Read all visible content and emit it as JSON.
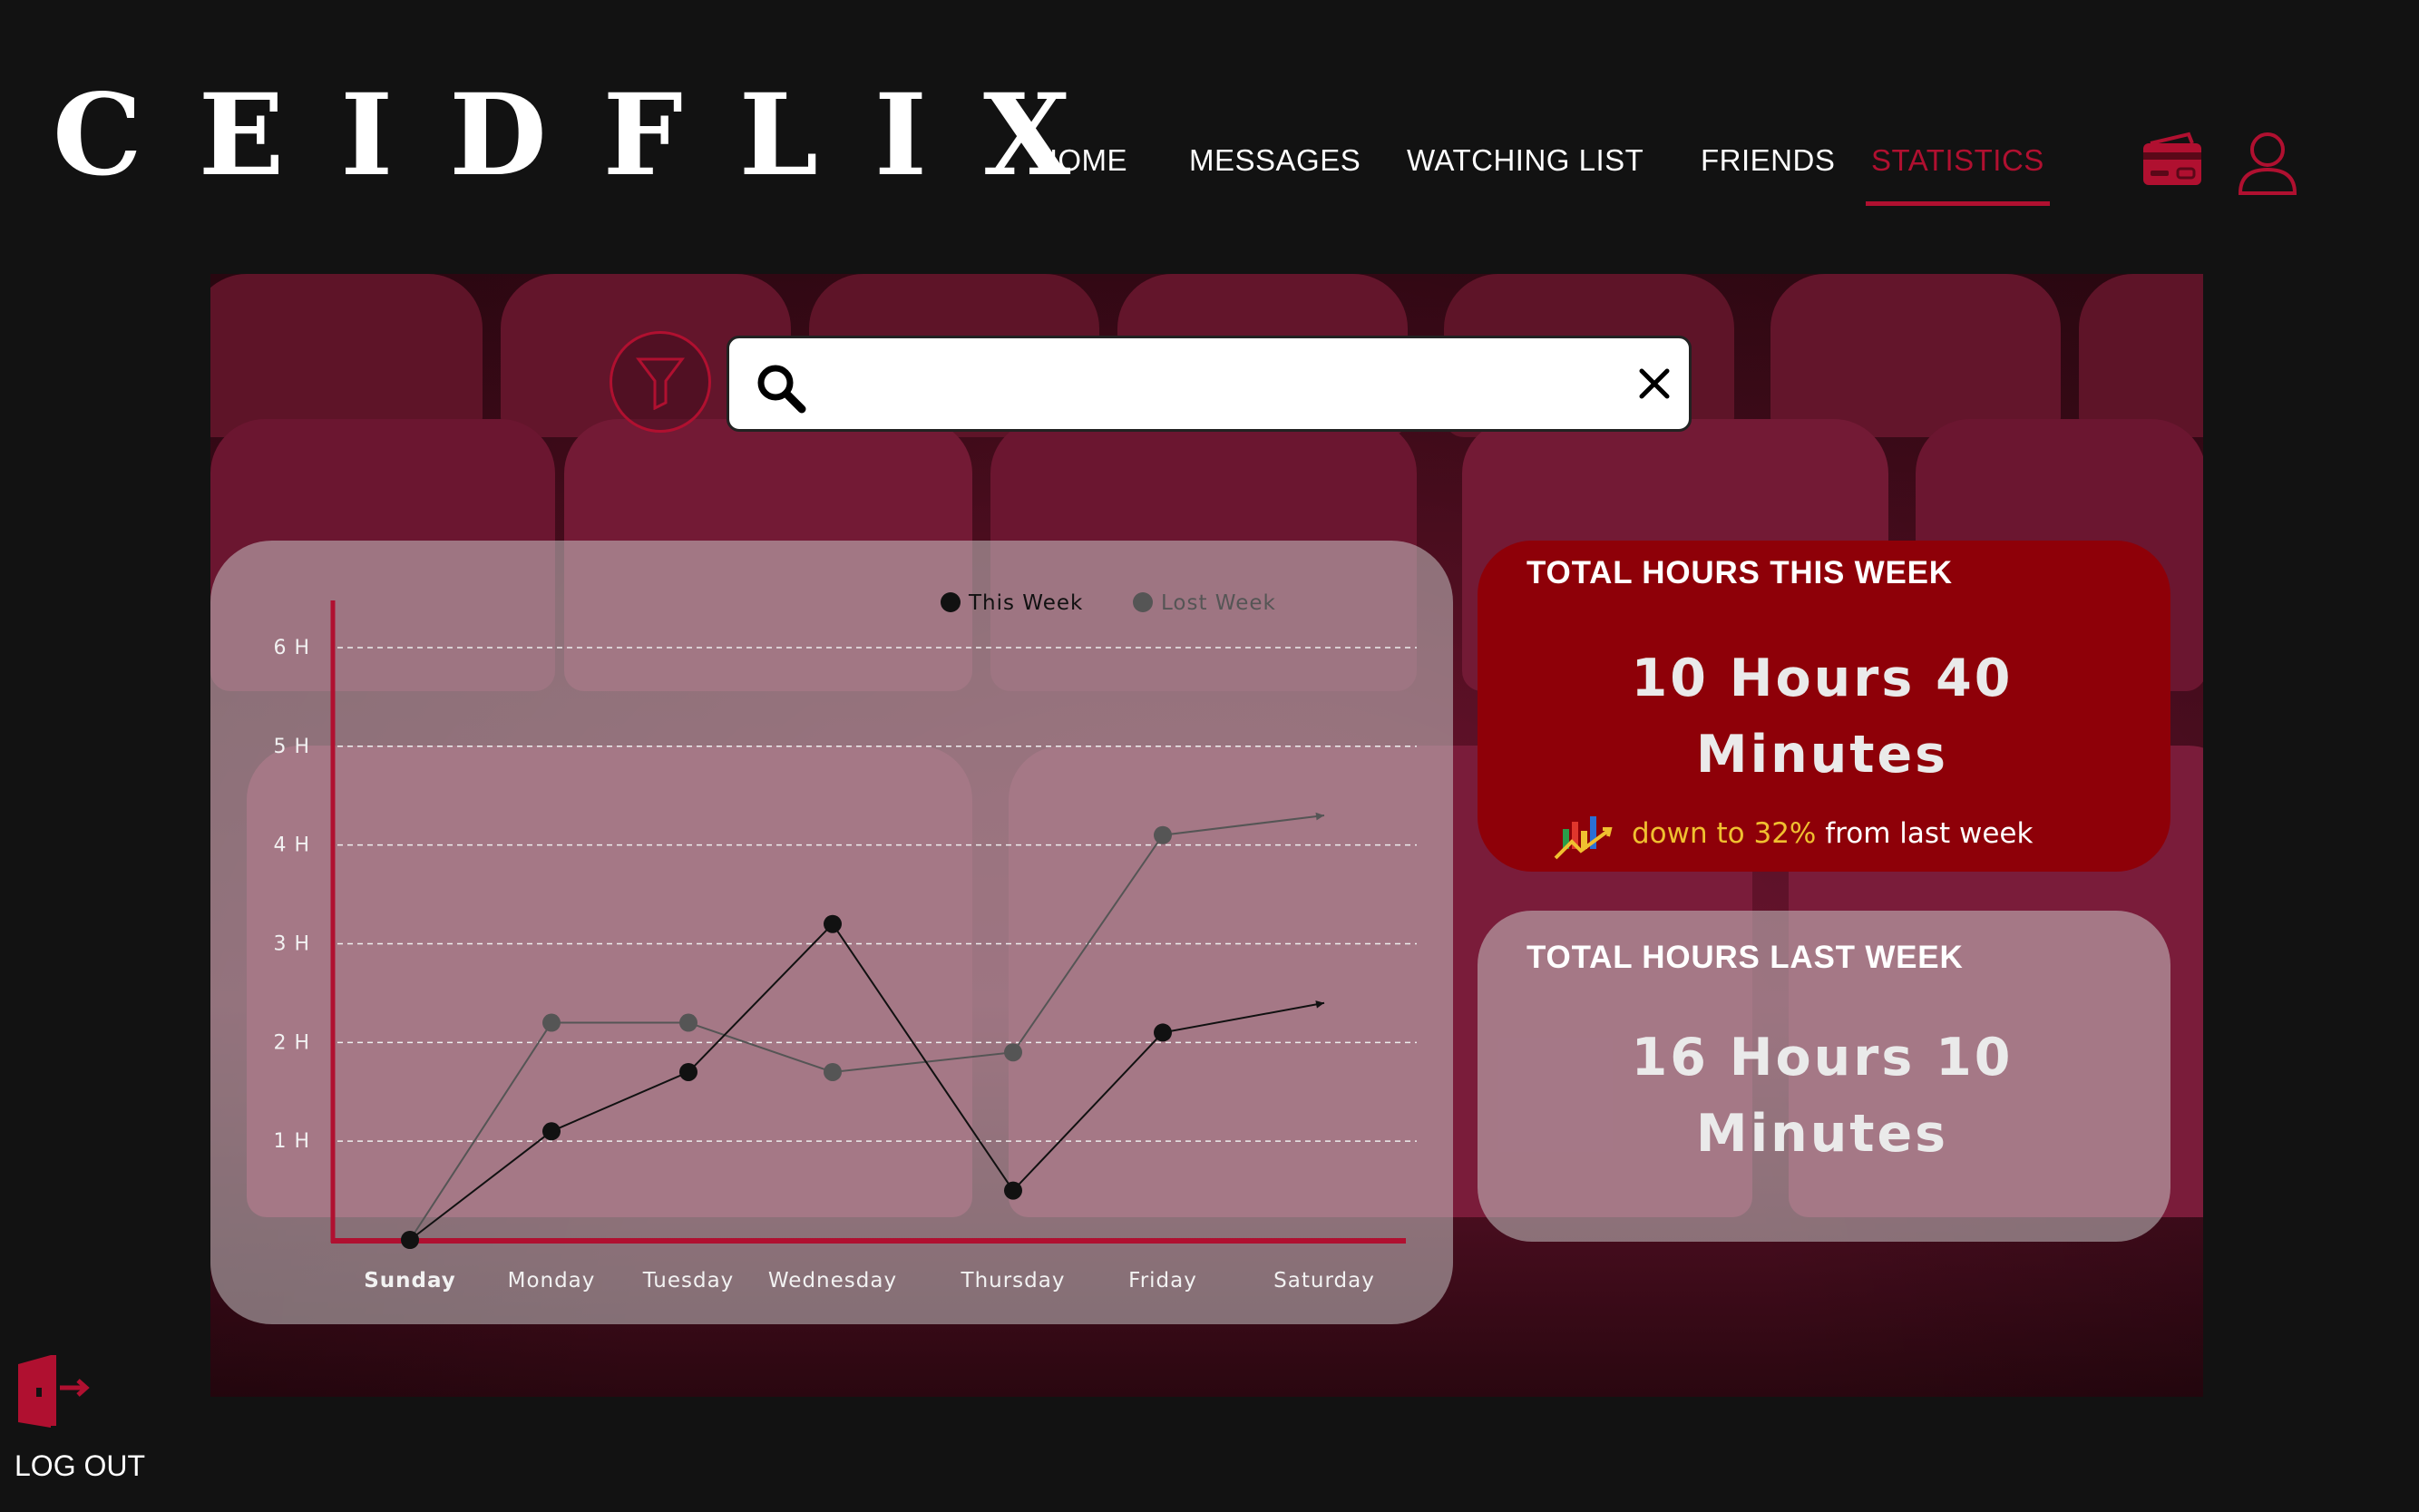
{
  "app": {
    "logo": "CEIDFLIX"
  },
  "nav": {
    "items": [
      {
        "label": "HOME",
        "active": false
      },
      {
        "label": "MESSAGES",
        "active": false
      },
      {
        "label": "WATCHING LIST",
        "active": false
      },
      {
        "label": "FRIENDS",
        "active": false
      },
      {
        "label": "STATISTICS",
        "active": true
      }
    ]
  },
  "header_icons": [
    "credit-card-icon",
    "user-icon"
  ],
  "search": {
    "value": "",
    "placeholder": ""
  },
  "colors": {
    "accent": "#b01030",
    "this_week_card": "#8e0008",
    "highlight": "#f0c030"
  },
  "stats": {
    "this_week": {
      "title": "TOTAL HOURS THIS WEEK",
      "value_line1": "10 Hours 40",
      "value_line2": "Minutes",
      "change_highlight": "down to 32%",
      "change_rest": " from last week"
    },
    "last_week": {
      "title": "TOTAL HOURS LAST WEEK",
      "value_line1": "16 Hours 10",
      "value_line2": "Minutes"
    }
  },
  "logout": {
    "label": "LOG OUT"
  },
  "chart_data": {
    "type": "line",
    "categories": [
      "Sunday",
      "Monday",
      "Tuesday",
      "Wednesday",
      "Thursday",
      "Friday",
      "Saturday"
    ],
    "y_ticks": [
      "1 H",
      "2 H",
      "3 H",
      "4 H",
      "5 H",
      "6 H"
    ],
    "ylim": [
      0,
      6
    ],
    "grid": true,
    "legend_position": "top",
    "series": [
      {
        "name": "This Week",
        "color": "#111111",
        "values": [
          0,
          1.1,
          1.7,
          3.2,
          0.5,
          2.1,
          2.4
        ]
      },
      {
        "name": "Lost Week",
        "color": "#555555",
        "values": [
          0,
          2.2,
          2.2,
          1.7,
          1.9,
          4.1,
          4.3
        ]
      }
    ]
  }
}
